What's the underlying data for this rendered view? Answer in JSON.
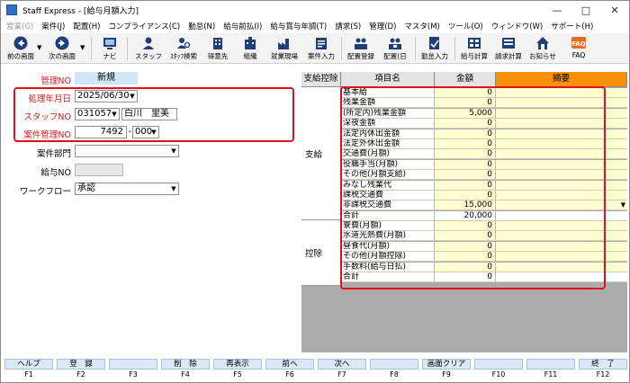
{
  "window": {
    "title": "Staff Express - [給与月額入力]",
    "minimize": "—",
    "maximize": "□",
    "close": "✕"
  },
  "menu": [
    {
      "label": "営業(G)",
      "disabled": true
    },
    {
      "label": "案件(J)",
      "disabled": false
    },
    {
      "label": "配置(H)",
      "disabled": false
    },
    {
      "label": "コンプライアンス(C)",
      "disabled": false
    },
    {
      "label": "勤怠(N)",
      "disabled": false
    },
    {
      "label": "給与前払(I)",
      "disabled": false
    },
    {
      "label": "給与賞与年調(T)",
      "disabled": false
    },
    {
      "label": "請求(S)",
      "disabled": false
    },
    {
      "label": "管理(D)",
      "disabled": false
    },
    {
      "label": "マスタ(M)",
      "disabled": false
    },
    {
      "label": "ツール(O)",
      "disabled": false
    },
    {
      "label": "ウィンドウ(W)",
      "disabled": false
    },
    {
      "label": "サポート(H)",
      "disabled": false
    }
  ],
  "toolbar": {
    "prev": "前の画面",
    "next": "次の画面",
    "navi": "ナビ",
    "staff": "スタッフ",
    "staff_search": "ｽﾀｯﾌ検索",
    "client": "得意先",
    "org": "組織",
    "site": "就業現場",
    "case_input": "案件入力",
    "assign_input": "配置登録",
    "assign_day": "配置(日",
    "attendance": "勤怠入力",
    "payroll_calc": "給与計算",
    "billing_calc": "請求計算",
    "notice": "お知らせ",
    "faq": "FAQ",
    "faq_badge": "FAQ"
  },
  "form": {
    "kanri_label": "管理NO",
    "kanri_value": "新規",
    "date_label": "処理年月日",
    "date_value": "2025/06/30",
    "staff_label": "スタッフNO",
    "staff_no": "031057",
    "staff_name": "白川　里美",
    "case_label": "案件管理NO",
    "case_no": "7492",
    "case_dash": "-",
    "case_sub": "000",
    "dept_label": "案件部門",
    "dept_value": "",
    "salary_label": "給与NO",
    "salary_value": "",
    "workflow_label": "ワークフロー",
    "workflow_value": "承認"
  },
  "grid": {
    "headers": {
      "group": "支給控除",
      "item": "項目名",
      "amount": "金額",
      "note": "摘要"
    },
    "group_shikyu": "支給",
    "group_koujo": "控除",
    "shikyu_rows": [
      {
        "name": "基本給",
        "amount": "0",
        "note": ""
      },
      {
        "name": "残業金額",
        "amount": "0",
        "note": ""
      },
      {
        "name": "(所定内)残業金額",
        "amount": "5,000",
        "note": ""
      },
      {
        "name": "深夜金額",
        "amount": "0",
        "note": ""
      },
      {
        "name": "法定内休出金額",
        "amount": "0",
        "note": ""
      },
      {
        "name": "法定外休出金額",
        "amount": "0",
        "note": ""
      },
      {
        "name": "交通費(月額)",
        "amount": "0",
        "note": ""
      },
      {
        "name": "役職手当(月額)",
        "amount": "0",
        "note": ""
      },
      {
        "name": "その他(月額支給)",
        "amount": "0",
        "note": ""
      },
      {
        "name": "みなし残業代",
        "amount": "0",
        "note": ""
      },
      {
        "name": "課税交通費",
        "amount": "0",
        "note": ""
      },
      {
        "name": "非課税交通費",
        "amount": "15,000",
        "note": ""
      },
      {
        "name": "合計",
        "amount": "20,000",
        "note": ""
      }
    ],
    "koujo_rows": [
      {
        "name": "寮費(月額)",
        "amount": "0",
        "note": ""
      },
      {
        "name": "水道光熱費(月額)",
        "amount": "0",
        "note": ""
      },
      {
        "name": "昼食代(月額)",
        "amount": "0",
        "note": ""
      },
      {
        "name": "その他(月額控除)",
        "amount": "0",
        "note": ""
      },
      {
        "name": "手数料(給与日払)",
        "amount": "0",
        "note": ""
      },
      {
        "name": "合計",
        "amount": "0",
        "note": ""
      }
    ]
  },
  "fkeys": [
    {
      "label": "ヘルプ",
      "key": "F1"
    },
    {
      "label": "登　録",
      "key": "F2"
    },
    {
      "label": "",
      "key": "F3"
    },
    {
      "label": "削　除",
      "key": "F4"
    },
    {
      "label": "再表示",
      "key": "F5"
    },
    {
      "label": "前へ",
      "key": "F6"
    },
    {
      "label": "次へ",
      "key": "F7"
    },
    {
      "label": "",
      "key": "F8"
    },
    {
      "label": "画面クリア",
      "key": "F9"
    },
    {
      "label": "",
      "key": "F10"
    },
    {
      "label": "",
      "key": "F11"
    },
    {
      "label": "終　了",
      "key": "F12"
    }
  ],
  "colors": {
    "highlight_box": "#e0111a",
    "required_label": "#d8141a",
    "note_header": "#f7900a",
    "editable_cell": "#ffffd2",
    "new_badge": "#cfe7f6",
    "fkey_button": "#dbe8f7"
  }
}
